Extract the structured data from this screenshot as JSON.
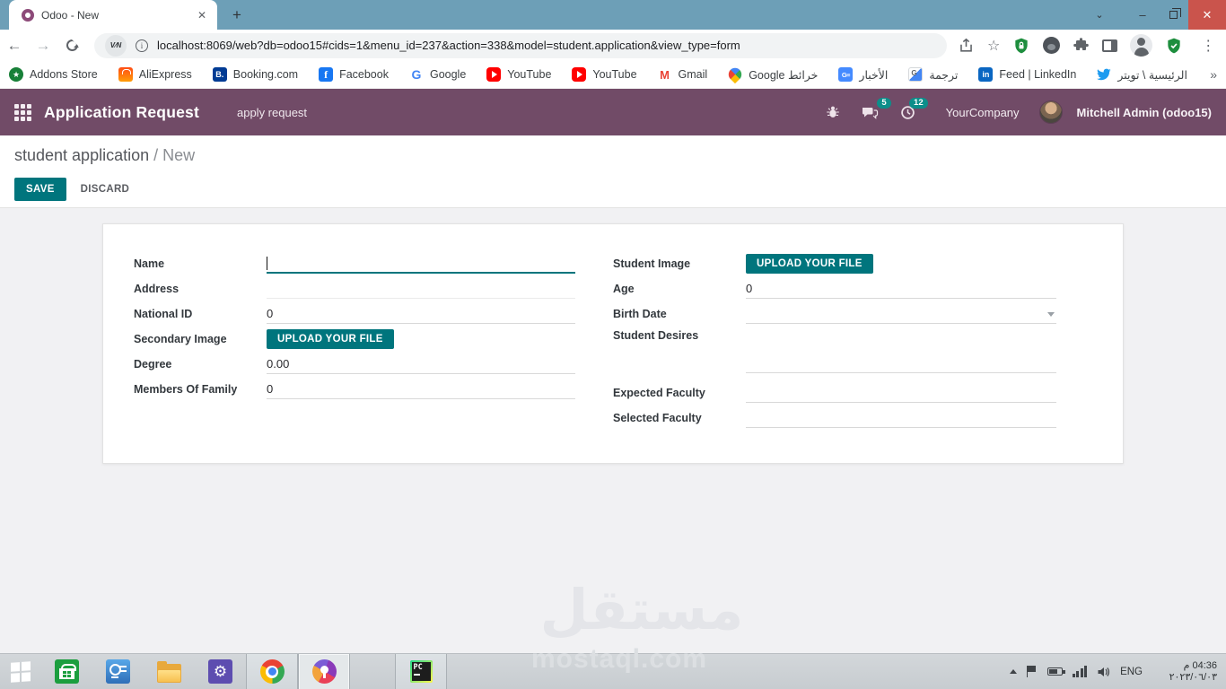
{
  "browser": {
    "tab_title": "Odoo - New",
    "vpn_badge": "V∕N",
    "url": "localhost:8069/web?db=odoo15#cids=1&menu_id=237&action=338&model=student.application&view_type=form",
    "bookmarks": [
      {
        "label": "Addons Store",
        "icon": "addons-store"
      },
      {
        "label": "AliExpress",
        "icon": "aliexpress"
      },
      {
        "label": "Booking.com",
        "icon": "booking"
      },
      {
        "label": "Facebook",
        "icon": "facebook"
      },
      {
        "label": "Google",
        "icon": "google"
      },
      {
        "label": "YouTube",
        "icon": "youtube"
      },
      {
        "label": "YouTube",
        "icon": "youtube"
      },
      {
        "label": "Gmail",
        "icon": "gmail"
      },
      {
        "label": "خرائط Google",
        "icon": "google-maps"
      },
      {
        "label": "الأخبار",
        "icon": "google-news"
      },
      {
        "label": "ترجمة",
        "icon": "google-translate"
      },
      {
        "label": "Feed | LinkedIn",
        "icon": "linkedin"
      },
      {
        "label": "الرئيسية \\ تويتر",
        "icon": "twitter"
      }
    ],
    "bookmarks_overflow": "»",
    "fav_letters": {
      "addons": "★",
      "booking": "B.",
      "facebook": "f",
      "google": "G",
      "gmail": "M",
      "news": "G≡",
      "translate": "G",
      "linkedin": "in"
    }
  },
  "navbar": {
    "app_title": "Application Request",
    "menu_item": "apply request",
    "messages_badge": "5",
    "activities_badge": "12",
    "company": "YourCompany",
    "user": "Mitchell Admin (odoo15)"
  },
  "control_panel": {
    "breadcrumb_parent": "student application",
    "breadcrumb_separator": " / ",
    "breadcrumb_current": "New",
    "save_label": "SAVE",
    "discard_label": "DISCARD"
  },
  "form": {
    "upload_label": "UPLOAD YOUR FILE",
    "left": [
      {
        "label": "Name",
        "value": "",
        "type": "text-focused"
      },
      {
        "label": "Address",
        "value": "",
        "type": "text"
      },
      {
        "label": "National ID",
        "value": "0",
        "type": "number"
      },
      {
        "label": "Secondary Image",
        "value": "",
        "type": "upload"
      },
      {
        "label": "Degree",
        "value": "0.00",
        "type": "number"
      },
      {
        "label": "Members Of Family",
        "value": "0",
        "type": "number"
      }
    ],
    "right": [
      {
        "label": "Student Image",
        "value": "",
        "type": "upload"
      },
      {
        "label": "Age",
        "value": "0",
        "type": "number"
      },
      {
        "label": "Birth Date",
        "value": "",
        "type": "date"
      },
      {
        "label": "Student Desires",
        "value": "",
        "type": "textarea"
      },
      {
        "label": "Expected Faculty",
        "value": "",
        "type": "text"
      },
      {
        "label": "Selected Faculty",
        "value": "",
        "type": "text"
      }
    ]
  },
  "watermark": {
    "brand_arabic": "مستقل",
    "brand_domain": "mostaql.com"
  },
  "taskbar": {
    "tray": {
      "language": "ENG",
      "time": "04:36 م",
      "date": "٢٠٢٣/٠٦/٠٣"
    }
  },
  "colors": {
    "odoo_purple": "#714B67",
    "odoo_teal": "#00757d",
    "badge_teal": "#0c8e8a",
    "tabstrip_blue": "#6d9fb7",
    "close_red": "#ca544c",
    "taskbar_gray": "#ccd1d5"
  }
}
